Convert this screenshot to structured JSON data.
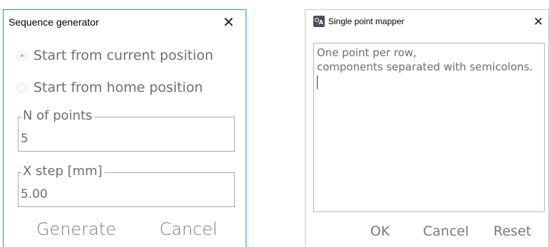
{
  "seq_window": {
    "title": "Sequence generator",
    "close_glyph": "✕",
    "radio_current_label": "Start from current position",
    "radio_home_label": "Start from home position",
    "radio_selected": "current",
    "n_points_label": "N of points",
    "n_points_value": "5",
    "x_step_label": "X step [mm]",
    "x_step_value": "5.00",
    "generate_label": "Generate",
    "cancel_label": "Cancel"
  },
  "mapper_window": {
    "title": "Single point mapper",
    "close_glyph": "✕",
    "app_icon_glyph": "A",
    "text_line_1": "One point per row,",
    "text_line_2": "components separated with semicolons.",
    "ok_label": "OK",
    "cancel_label": "Cancel",
    "reset_label": "Reset"
  },
  "colors": {
    "active_border": "#2b8fd8",
    "inactive_border": "#c9c9c9",
    "text_gray": "#6e6e6e"
  }
}
